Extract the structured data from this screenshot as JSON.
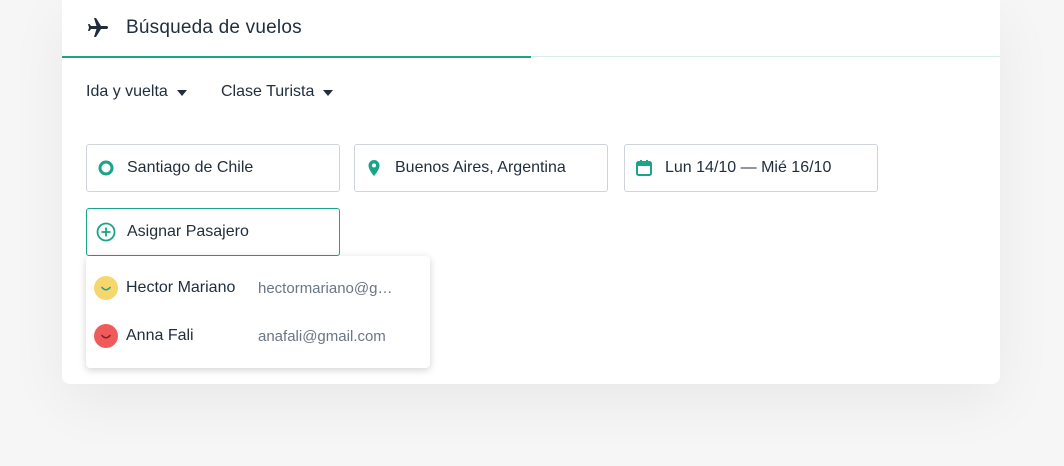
{
  "header": {
    "tab_title": "Búsqueda de vuelos",
    "tab_icon": "airplane-icon"
  },
  "options": {
    "trip_type": "Ida y vuelta",
    "cabin_class": "Clase Turista"
  },
  "search": {
    "origin": "Santiago de Chile",
    "destination": "Buenos Aires, Argentina",
    "dates": "Lun 14/10 — Mié 16/10",
    "assign_passenger": "Asignar Pasajero"
  },
  "passengers": [
    {
      "name": "Hector Mariano",
      "email": "hectormariano@gmail.com",
      "avatar_color": "#f5d76e"
    },
    {
      "name": "Anna Fali",
      "email": "anafali@gmail.com",
      "avatar_color": "#ef5b5b"
    }
  ],
  "colors": {
    "accent": "#1aa48a",
    "text": "#1f2d3d",
    "muted": "#6b7683"
  }
}
